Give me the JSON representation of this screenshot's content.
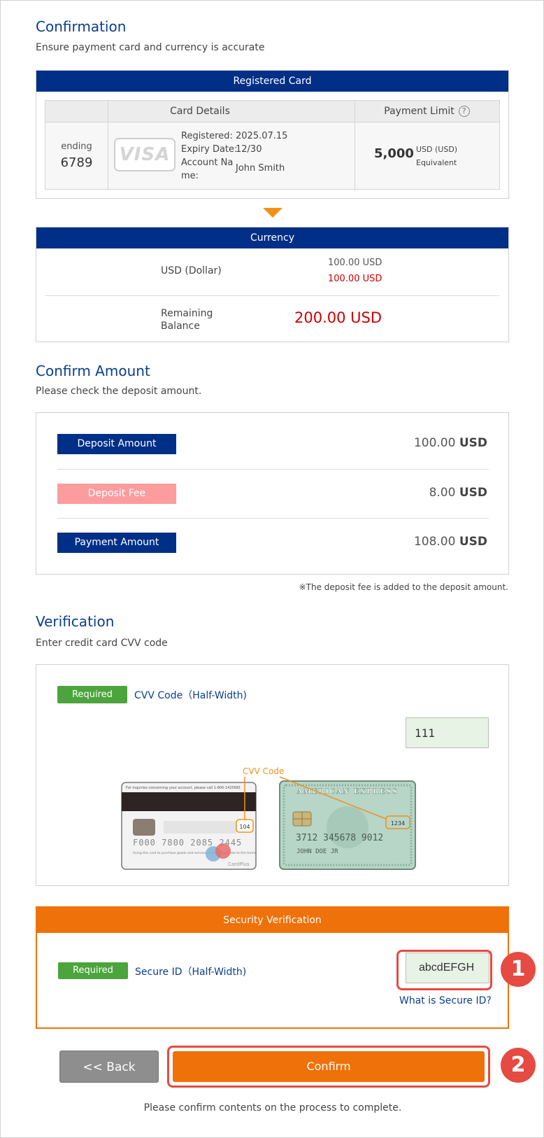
{
  "confirmation": {
    "title": "Confirmation",
    "subtitle": "Ensure payment card and currency is accurate",
    "registered_card_band": "Registered Card",
    "col_card_details": "Card Details",
    "col_payment_limit": "Payment Limit",
    "help_mark": "?",
    "card": {
      "ending_label": "ending",
      "ending_digits": "6789",
      "brand": "VISA",
      "registered_label": "Registered:",
      "registered_value": "2025.07.15",
      "expiry_label": "Expiry Date:",
      "expiry_value": "12/30",
      "account_label_1": "Account Na",
      "account_label_2": "me:",
      "account_value": "John Smith"
    },
    "limit": {
      "amount": "5,000",
      "currency": "USD (USD)",
      "equivalent": "Equivalent"
    }
  },
  "currency": {
    "band": "Currency",
    "row1_label": "USD (Dollar)",
    "row1_value_a": "100.00 USD",
    "row1_value_b": "100.00 USD",
    "row2_label_1": "Remaining",
    "row2_label_2": "Balance",
    "row2_value": "200.00 USD"
  },
  "confirm_amount": {
    "title": "Confirm Amount",
    "subtitle": "Please check the deposit amount.",
    "rows": [
      {
        "label": "Deposit Amount",
        "value": "100.00",
        "unit": "USD"
      },
      {
        "label": "Deposit Fee",
        "value": "8.00",
        "unit": "USD"
      },
      {
        "label": "Payment Amount",
        "value": "108.00",
        "unit": "USD"
      }
    ],
    "note": "※The deposit fee is added to the deposit amount."
  },
  "verification": {
    "title": "Verification",
    "subtitle": "Enter credit card CVV code",
    "required_label": "Required",
    "field_label": "CVV Code（Half-Width)",
    "cvv_value": "111",
    "cvv_callout": "CVV Code",
    "card_back": {
      "header_text": "For inquiries concerning your account, please call 1-800-1425681",
      "numbers": "F000 7800 2085 2445",
      "cvv": "104",
      "footer_text": "Using this card to purchase goods and services means you agree to the terms",
      "brand": "CardPlus"
    },
    "card_front": {
      "issuer": "AMERICAN EXPRESS",
      "number": "3712 345678 9012",
      "holder": "JOHN DOE JR",
      "cvv": "1234"
    }
  },
  "security": {
    "band": "Security Verification",
    "required_label": "Required",
    "field_label": "Secure ID（Half-Width)",
    "secure_id_value": "abcdEFGH",
    "help_link": "What is Secure ID?"
  },
  "actions": {
    "back_label": "<< Back",
    "confirm_label": "Confirm",
    "footer_note": "Please confirm contents on the process to complete.",
    "step1": "1",
    "step2": "2"
  },
  "colors": {
    "navy": "#002f87",
    "orange": "#ef7109",
    "green": "#4ca43c",
    "pink": "#fd9c9f",
    "red_badge": "#e54b42",
    "error_red": "#cc0000"
  }
}
